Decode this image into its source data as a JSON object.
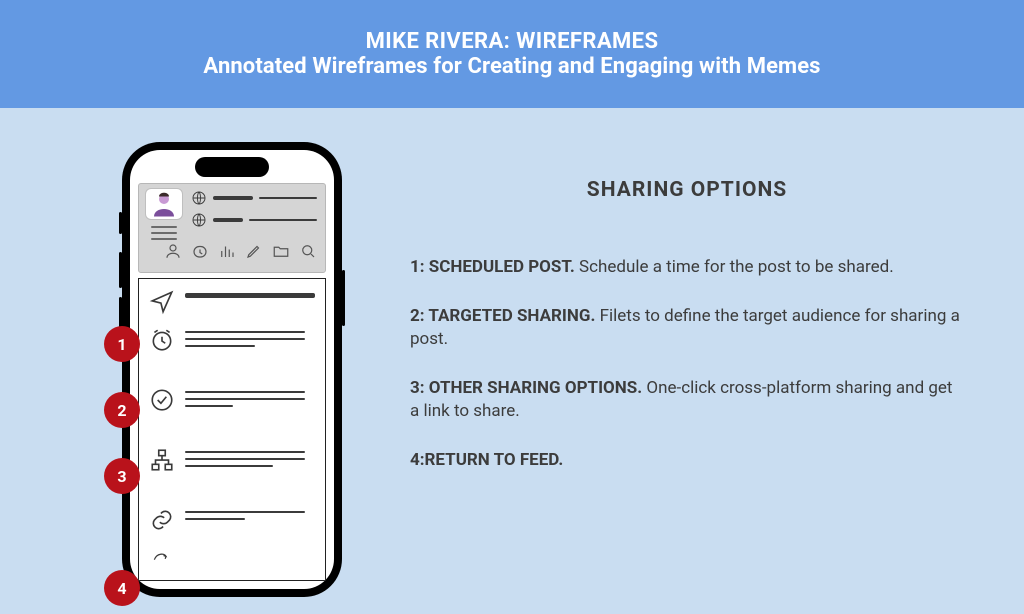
{
  "header": {
    "title": "MIKE RIVERA: WIREFRAMES",
    "subtitle": "Annotated Wireframes for Creating and Engaging with Memes"
  },
  "section_title": "SHARING OPTIONS",
  "badges": {
    "b1": "1",
    "b2": "2",
    "b3": "3",
    "b4": "4"
  },
  "notes": [
    {
      "label": "1: SCHEDULED POST. ",
      "text": "Schedule a time for the post to be shared."
    },
    {
      "label": "2: TARGETED SHARING. ",
      "text": "Filets to define the target audience for sharing a post."
    },
    {
      "label": "3: OTHER SHARING OPTIONS. ",
      "text": "One-click cross-platform sharing and get a link to share."
    },
    {
      "label": "4:RETURN TO FEED.",
      "text": ""
    }
  ]
}
